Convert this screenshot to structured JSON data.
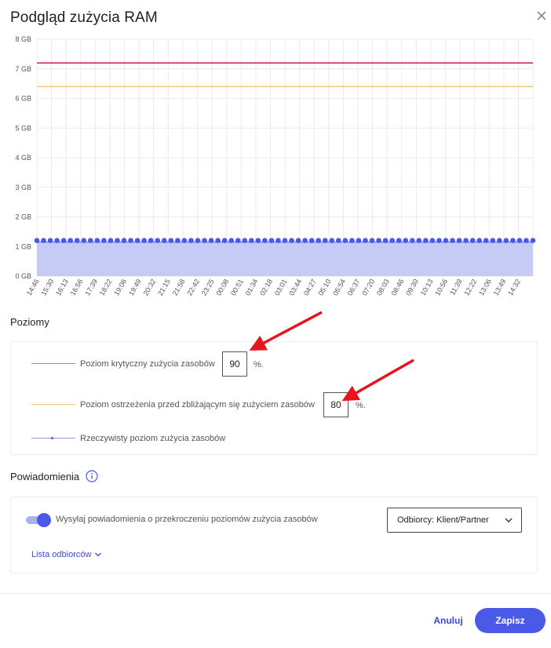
{
  "dialog": {
    "title": "Podgląd zużycia RAM",
    "close_icon": "close-icon"
  },
  "chart_data": {
    "type": "line",
    "ylabel": "",
    "xlabel": "",
    "y_ticks": [
      "0 GB",
      "1 GB",
      "2 GB",
      "3 GB",
      "4 GB",
      "5 GB",
      "6 GB",
      "7 GB",
      "8 GB"
    ],
    "ylim": [
      0,
      8
    ],
    "x_ticks": [
      "14:46",
      "15:30",
      "16:13",
      "16:56",
      "17:39",
      "18:22",
      "19:06",
      "19:49",
      "20:32",
      "21:15",
      "21:58",
      "22:42",
      "23:25",
      "00:08",
      "00:51",
      "01:34",
      "02:18",
      "03:01",
      "03:44",
      "04:27",
      "05:10",
      "05:54",
      "06:37",
      "07:20",
      "08:03",
      "08:46",
      "09:30",
      "10:13",
      "10:56",
      "11:39",
      "12:22",
      "13:06",
      "13:49",
      "14:32"
    ],
    "grid": true,
    "point_count": 75,
    "series": [
      {
        "name": "Poziom krytyczny zużycia zasobów",
        "kind": "threshold",
        "value": 7.2,
        "color": "#c8223d"
      },
      {
        "name": "Poziom ostrzeżenia przed zbliżającym się zużyciem zasobów",
        "kind": "threshold",
        "value": 6.4,
        "color": "#f2c57c"
      },
      {
        "name": "Rzeczywisty poziom zużycia zasobów",
        "kind": "area",
        "value": 1.15,
        "color": "#4a5ae6",
        "fill": "#c5cbf5"
      }
    ]
  },
  "levels": {
    "heading": "Poziomy",
    "critical": {
      "label": "Poziom krytyczny zużycia zasobów",
      "value": "90",
      "unit": "%.",
      "color": "#e06b7a"
    },
    "warning": {
      "label": "Poziom ostrzeżenia przed zbliżającym się zużyciem zasobów",
      "value": "80",
      "unit": "%.",
      "color": "#f2c57c"
    },
    "actual": {
      "label": "Rzeczywisty poziom zużycia zasobów",
      "color": "#8f9bea"
    }
  },
  "notifications": {
    "heading": "Powiadomienia",
    "info_icon": "info-icon",
    "toggle_on": true,
    "toggle_label": "Wysyłaj powiadomienia o przekroczeniu poziomów zużycia zasobów",
    "recipients_select": "Odbiorcy: Klient/Partner",
    "recipients_link": "Lista odbiorców"
  },
  "footer": {
    "cancel_label": "Anuluj",
    "save_label": "Zapisz"
  },
  "colors": {
    "accent": "#4a5ae6",
    "annotation_arrow": "#e8141c"
  }
}
